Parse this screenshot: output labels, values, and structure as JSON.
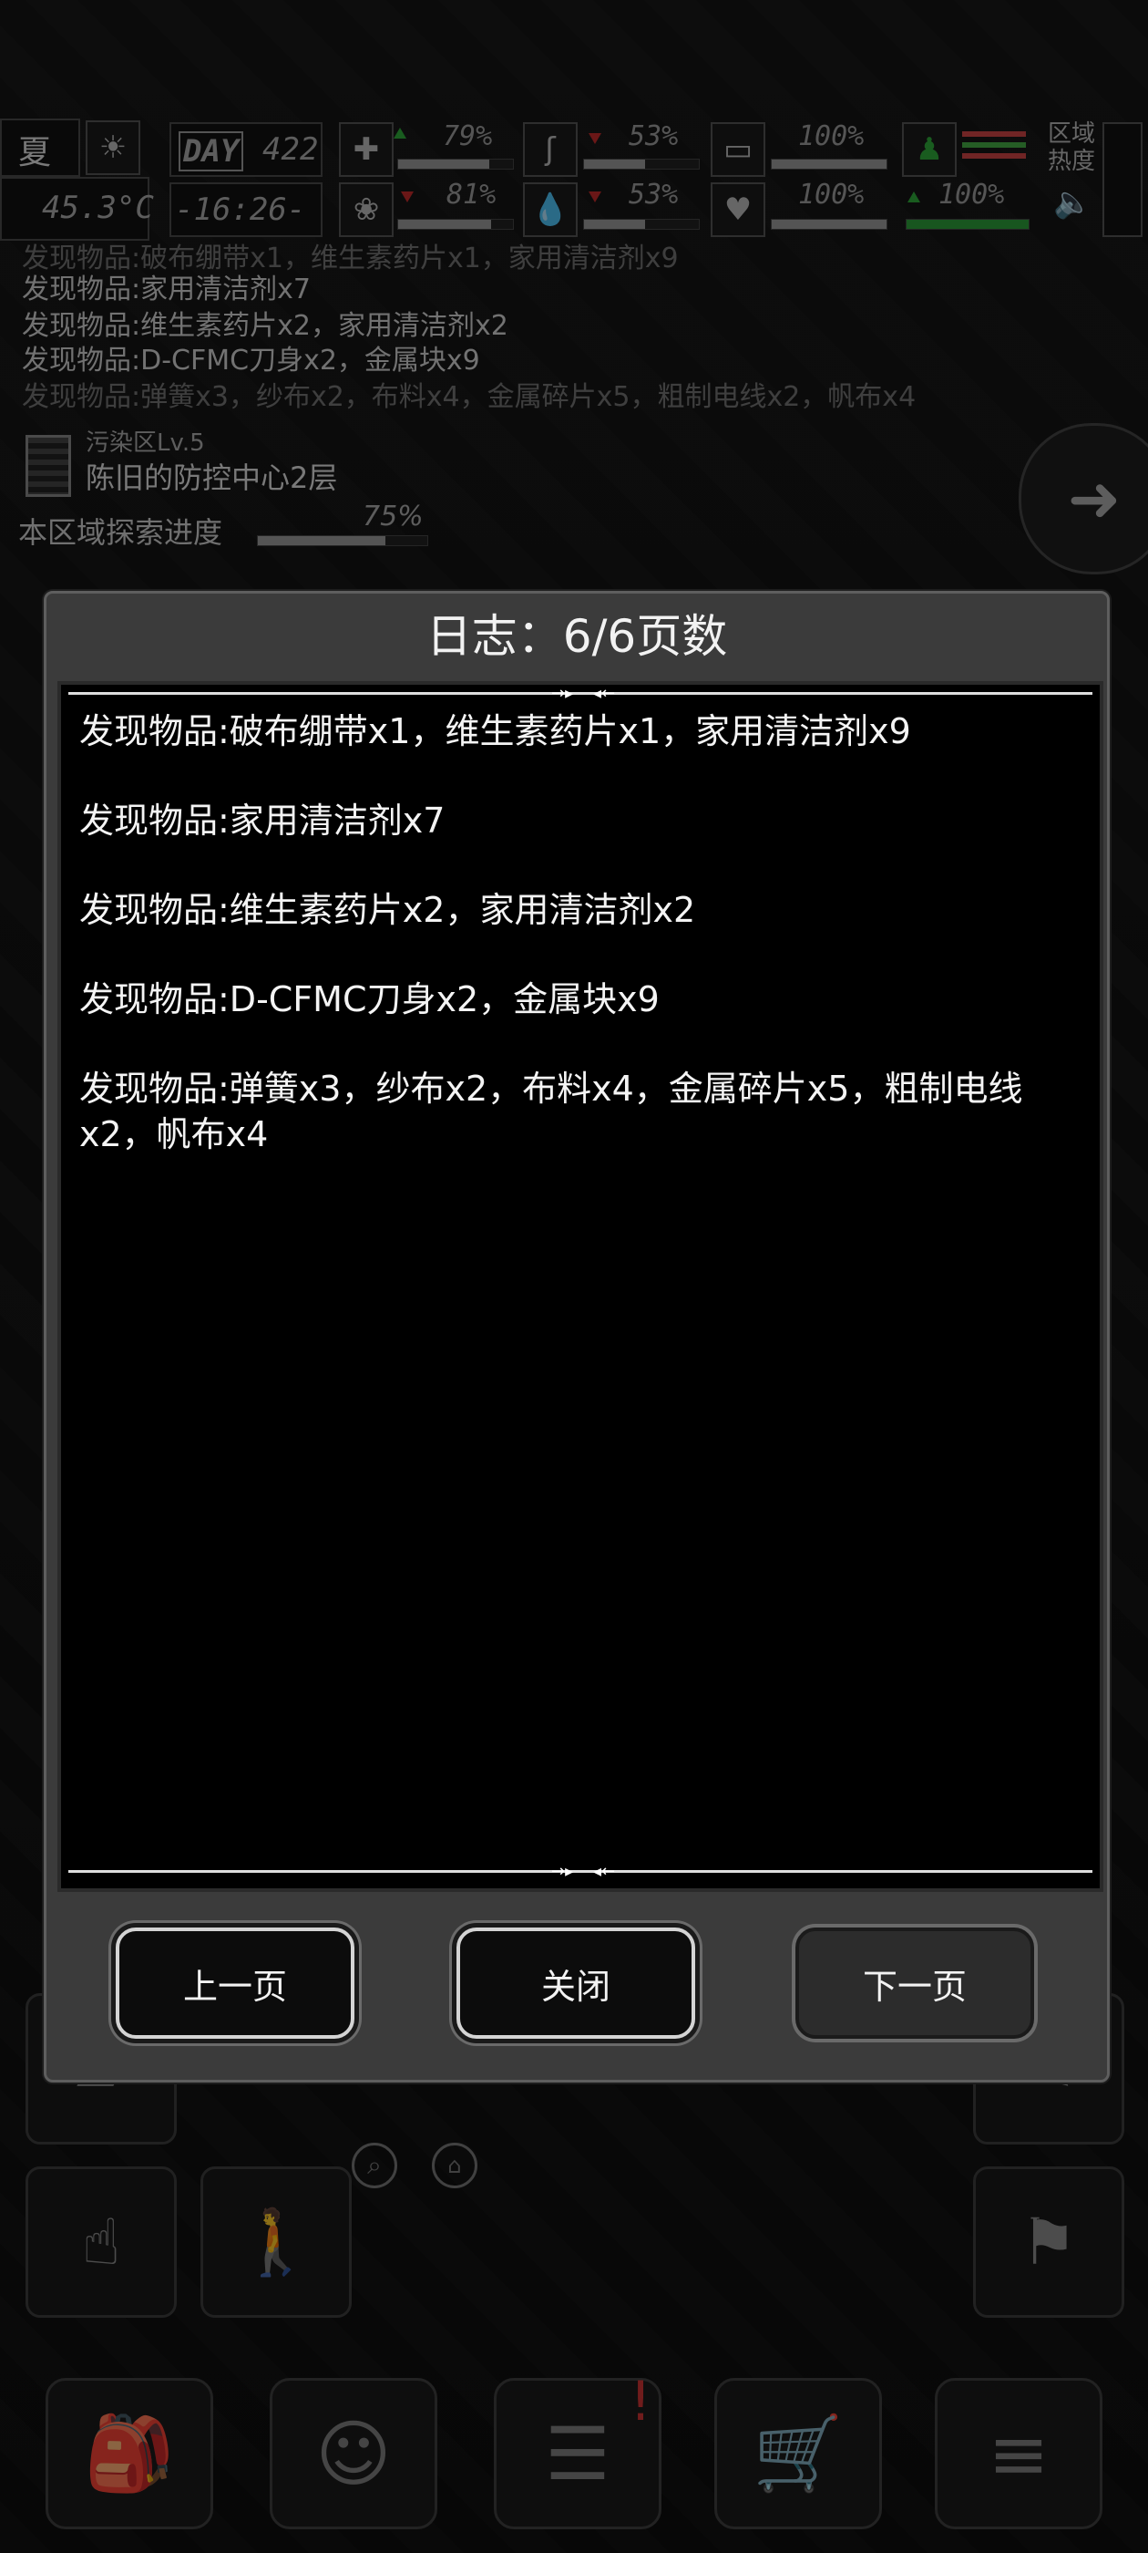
{
  "status": {
    "season": "夏",
    "temperature": "45.3°C",
    "day_label": "DAY",
    "day_number": "422",
    "clock": "-16:26-",
    "stats": [
      {
        "icon": "medkit-icon",
        "value": "79%",
        "trend": "up",
        "fill": 0.79
      },
      {
        "icon": "stomach-icon",
        "value": "53%",
        "trend": "down",
        "fill": 0.53
      },
      {
        "icon": "battery-icon",
        "value": "100%",
        "trend": "none",
        "fill": 1.0
      },
      {
        "icon": "brain-icon",
        "value": "81%",
        "trend": "down",
        "fill": 0.81
      },
      {
        "icon": "water-drop-icon",
        "value": "53%",
        "trend": "down",
        "fill": 0.53
      },
      {
        "icon": "heart-icon",
        "value": "100%",
        "trend": "none",
        "fill": 1.0
      },
      {
        "icon": "person-icon",
        "value": "100%",
        "trend": "up",
        "fill": 1.0
      }
    ],
    "zone_heat_label": "区域热度"
  },
  "background_log": [
    "发现物品:破布绷带x1，维生素药片x1，家用清洁剂x9",
    "发现物品:家用清洁剂x7",
    "发现物品:维生素药片x2，家用清洁剂x2",
    "发现物品:D-CFMC刀身x2，金属块x9",
    "发现物品:弹簧x3，纱布x2，布料x4，金属碎片x5，粗制电线x2，帆布x4"
  ],
  "area": {
    "level": "污染区Lv.5",
    "name": "陈旧的防控中心2层",
    "progress_label": "本区域探索进度",
    "progress_value": "75%",
    "progress_fill": 0.75
  },
  "modal": {
    "title": "日志：6/6页数",
    "entries": [
      "发现物品:破布绷带x1，维生素药片x1，家用清洁剂x9",
      "发现物品:家用清洁剂x7",
      "发现物品:维生素药片x2，家用清洁剂x2",
      "发现物品:D-CFMC刀身x2，金属块x9",
      "发现物品:弹簧x3，纱布x2，布料x4，金属碎片x5，粗制电线x2，帆布x4"
    ],
    "prev_label": "上一页",
    "close_label": "关闭",
    "next_label": "下一页"
  },
  "nav": [
    {
      "icon": "backpack-icon"
    },
    {
      "icon": "brain-profile-icon"
    },
    {
      "icon": "notes-icon"
    },
    {
      "icon": "shopping-cart-icon"
    },
    {
      "icon": "menu-list-icon"
    }
  ]
}
